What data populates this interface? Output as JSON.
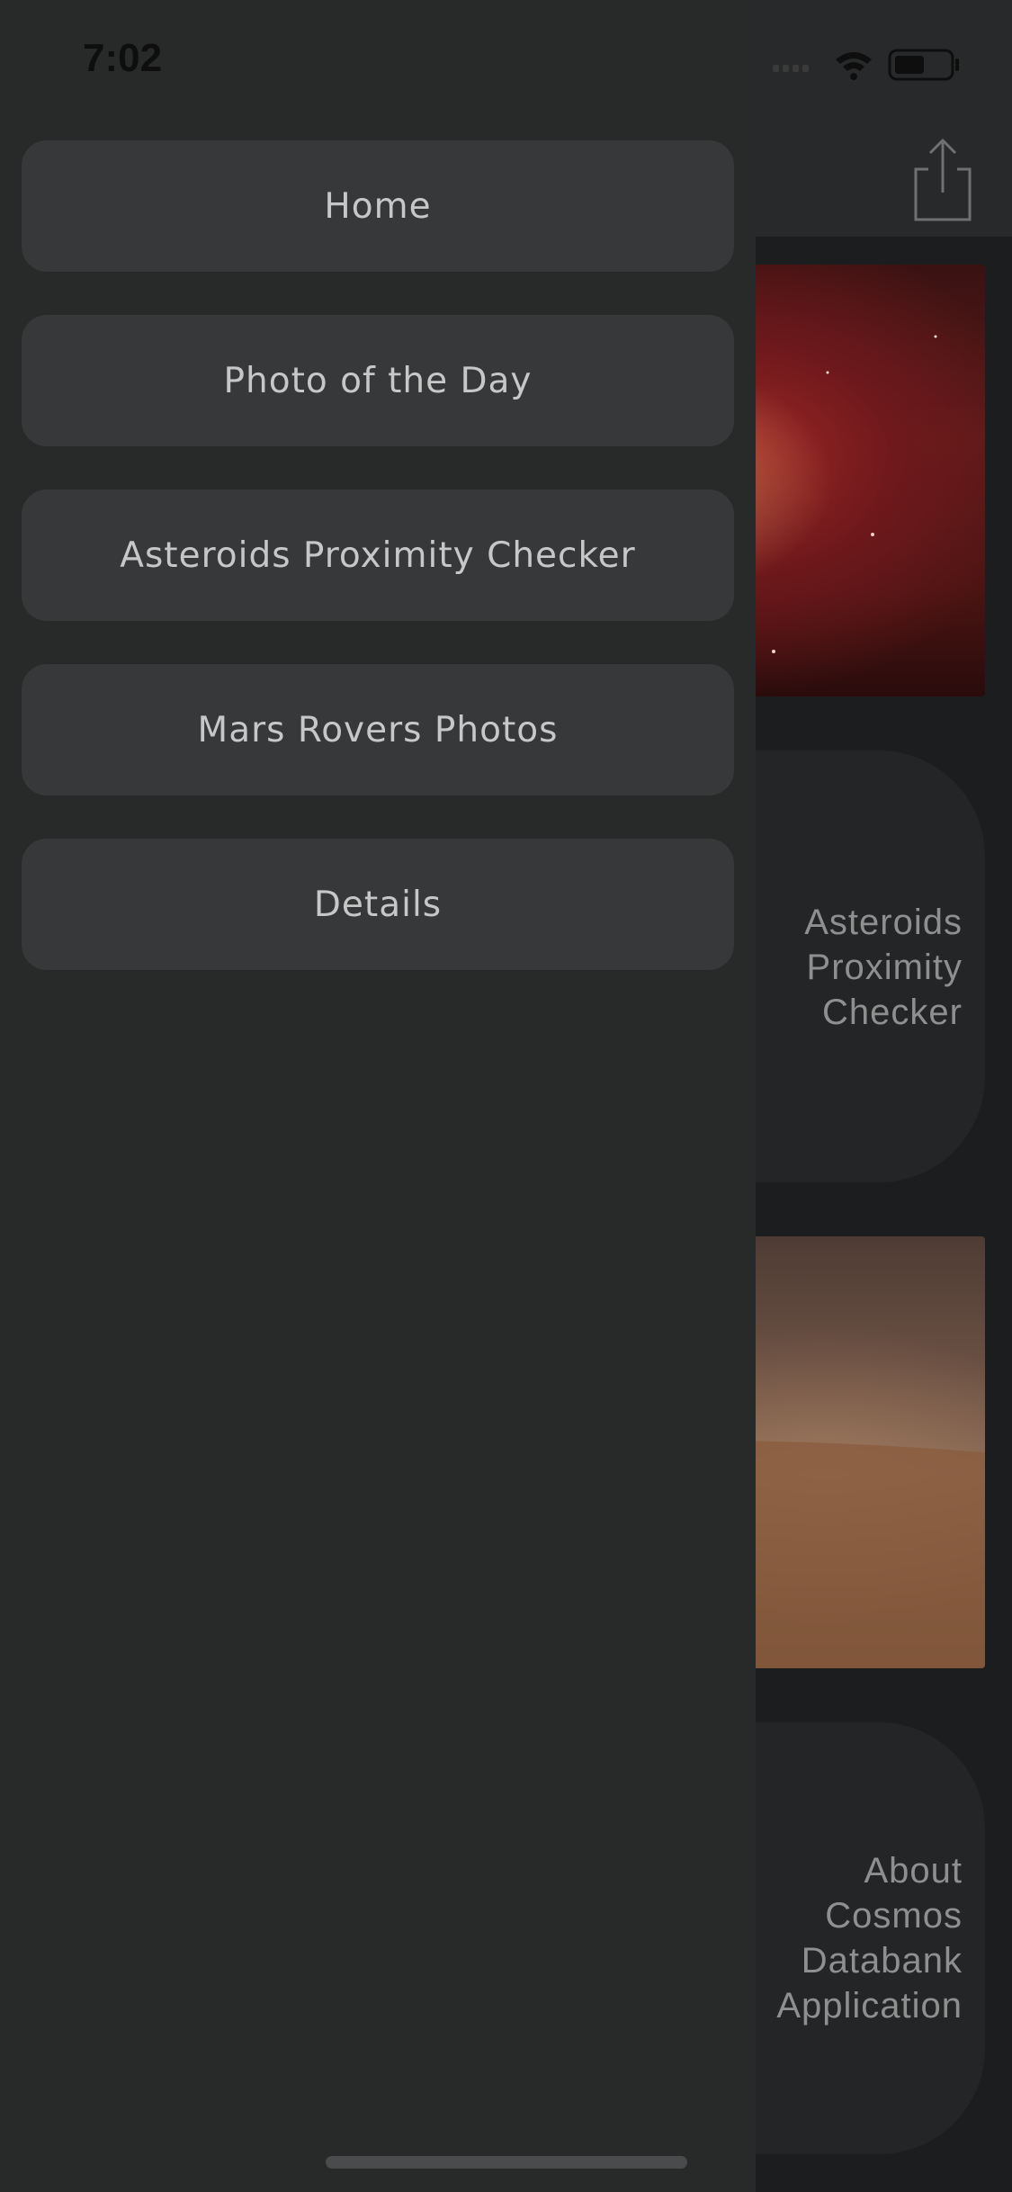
{
  "status_bar": {
    "time": "7:02",
    "icons": [
      "cellular-icon",
      "wifi-icon",
      "battery-icon"
    ]
  },
  "toolbar": {
    "share_icon": "share-icon"
  },
  "drawer": {
    "items": [
      {
        "label": "Home"
      },
      {
        "label": "Photo of the Day"
      },
      {
        "label": "Asteroids Proximity Checker"
      },
      {
        "label": "Mars Rovers Photos"
      },
      {
        "label": "Details"
      }
    ]
  },
  "background": {
    "cards": [
      {
        "type": "image",
        "subject": "nebula"
      },
      {
        "type": "text",
        "lines": [
          "Asteroids",
          "Proximity",
          "Checker"
        ]
      },
      {
        "type": "image",
        "subject": "mars-rover"
      },
      {
        "type": "text",
        "lines": [
          "About",
          "Cosmos",
          "Databank",
          "Application"
        ]
      }
    ]
  },
  "colors": {
    "drawer_bg": "#282929",
    "menu_item_bg": "#363839",
    "menu_text": "#c6c7c7",
    "card_text": "#8e8f8f"
  }
}
